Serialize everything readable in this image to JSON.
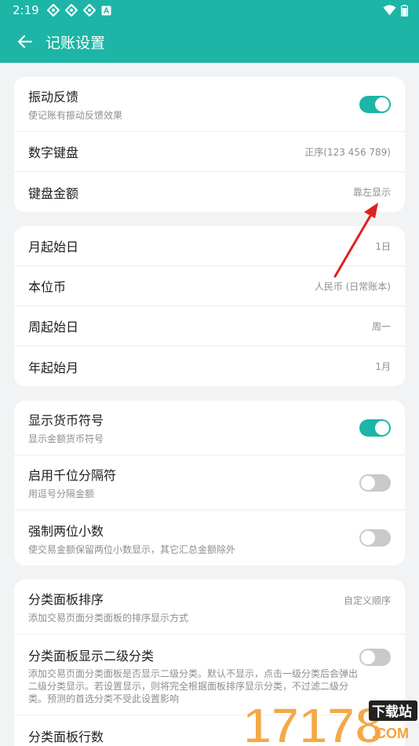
{
  "status_bar": {
    "time": "2:19",
    "colors": {
      "bg": "#1cb5a6"
    }
  },
  "app_bar": {
    "title": "记账设置"
  },
  "sections": {
    "s1": {
      "vibration": {
        "label": "振动反馈",
        "sub": "使记账有振动反馈效果",
        "on": true
      },
      "numeric_keyboard": {
        "label": "数字键盘",
        "value": "正序(123 456 789)"
      },
      "keyboard_amount": {
        "label": "键盘金额",
        "value": "靠左显示"
      }
    },
    "s2": {
      "month_start_day": {
        "label": "月起始日",
        "value": "1日"
      },
      "base_currency": {
        "label": "本位币",
        "value": "人民币 (日常账本)"
      },
      "week_start_day": {
        "label": "周起始日",
        "value": "周一"
      },
      "year_start_month": {
        "label": "年起始月",
        "value": "1月"
      }
    },
    "s3": {
      "show_currency_symbol": {
        "label": "显示货币符号",
        "sub": "显示金额货币符号",
        "on": true
      },
      "thousand_separator": {
        "label": "启用千位分隔符",
        "sub": "用逗号分隔金额",
        "on": false
      },
      "force_two_decimals": {
        "label": "强制两位小数",
        "sub": "使交易金额保留两位小数显示，其它汇总金额除外",
        "on": false
      }
    },
    "s4": {
      "category_panel_sort": {
        "label": "分类面板排序",
        "sub": "添加交易页面分类面板的排序显示方式",
        "value": "自定义顺序"
      },
      "category_panel_secondary": {
        "label": "分类面板显示二级分类",
        "sub": "添加交易页面分类面板是否显示二级分类。默认不显示，点击一级分类后会弹出二级分类显示。若设置显示，则将完全根据面板排序显示分类，不过滤二级分类。预测的首选分类不受此设置影响",
        "on": false
      },
      "category_panel_rows": {
        "label": "分类面板行数"
      }
    }
  },
  "watermark": {
    "number": "17178",
    "badge": "下载站",
    "domain": ".COM"
  },
  "colors": {
    "accent": "#1cb5a6",
    "toggle_off": "#c9c9c9",
    "annotation_arrow": "#e02020"
  }
}
